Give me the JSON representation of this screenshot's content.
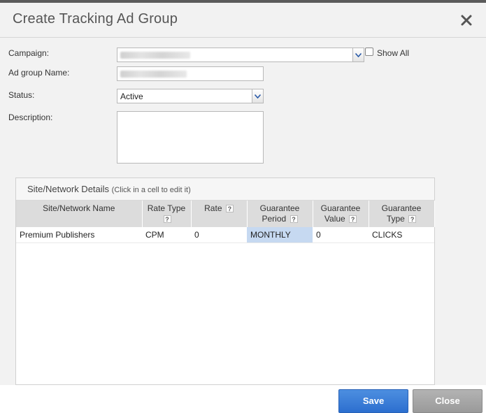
{
  "dialog": {
    "title": "Create Tracking Ad Group"
  },
  "form": {
    "campaign_label": "Campaign:",
    "ad_group_name_label": "Ad group Name:",
    "status_label": "Status:",
    "status_value": "Active",
    "description_label": "Description:",
    "show_all_label": "Show All",
    "show_all_checked": false
  },
  "details": {
    "heading": "Site/Network Details",
    "hint": "(Click in a cell to edit it)",
    "columns": [
      {
        "line1": "Site/Network Name",
        "line2": "",
        "help": false
      },
      {
        "line1": "Rate Type",
        "line2": "",
        "help": true
      },
      {
        "line1": "Rate",
        "line2": "",
        "help": true
      },
      {
        "line1": "Guarantee",
        "line2": "Period",
        "help": true
      },
      {
        "line1": "Guarantee",
        "line2": "Value",
        "help": true
      },
      {
        "line1": "Guarantee",
        "line2": "Type",
        "help": true
      }
    ],
    "help_glyph": "?",
    "rows": [
      {
        "site": "Premium Publishers",
        "rate_type": "CPM",
        "rate": "0",
        "guarantee_period": "MONTHLY",
        "guarantee_value": "0",
        "guarantee_type": "CLICKS"
      }
    ]
  },
  "footer": {
    "save_label": "Save",
    "close_label": "Close"
  },
  "colors": {
    "save": "#2c6fcf",
    "close": "#9a9a9a",
    "selected_cell": "#c6d9f1"
  },
  "icons": {
    "close": "close-icon",
    "dropdown": "chevron-down-icon",
    "help": "help-icon"
  }
}
